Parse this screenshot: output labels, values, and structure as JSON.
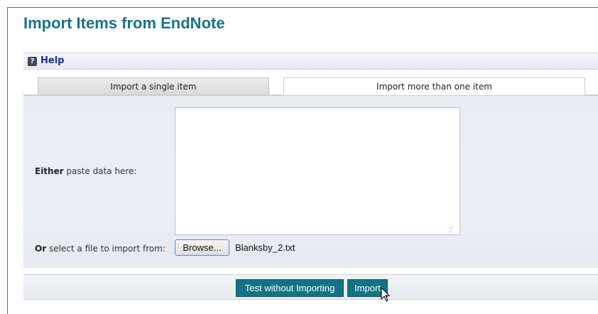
{
  "page": {
    "title": "Import Items from EndNote"
  },
  "help": {
    "icon": "question-icon",
    "icon_glyph": "?",
    "label": "Help"
  },
  "tabs": [
    {
      "label": "Import a single item",
      "active": false
    },
    {
      "label": "Import more than one item",
      "active": true
    }
  ],
  "form": {
    "paste_label_bold": "Either",
    "paste_label_rest": " paste data here:",
    "paste_value": "",
    "file_label_bold": "Or",
    "file_label_rest": " select a file to import from:",
    "browse_label": "Browse...",
    "file_name": "Blanksby_2.txt"
  },
  "actions": {
    "test_label": "Test without Importing",
    "import_label": "Import"
  },
  "colors": {
    "title": "#1a7387",
    "primary_button": "#137384",
    "help_link": "#1b2f8f"
  }
}
